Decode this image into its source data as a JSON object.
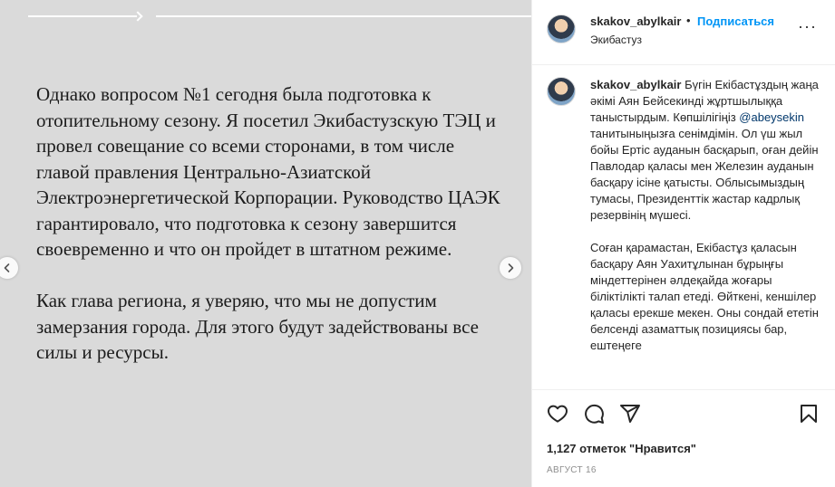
{
  "slide": {
    "paragraphs": [
      "Однако вопросом №1 сегодня была подготовка к отопительному сезону. Я посетил Экибастузскую ТЭЦ и провел совещание со всеми сторонами, в том числе главой правления Центрально-Азиатской Электроэнергетической Корпорации. Руководство ЦАЭК гарантировало, что подготовка к сезону завершится своевременно и что он пройдет в штатном режиме.",
      "Как глава региона, я уверяю, что мы не допустим замерзания города. Для этого будут задействованы все силы и ресурсы."
    ],
    "prev_icon": "chevron-left-icon",
    "next_icon": "chevron-right-icon"
  },
  "header": {
    "username": "skakov_abylkair",
    "separator": "•",
    "follow_label": "Подписаться",
    "location": "Экибастуз",
    "more_icon": "more-horizontal-icon"
  },
  "caption": {
    "username": "skakov_abylkair",
    "p1_start": "Бүгін Екібастұздың жаңа әкімі Аян Бейсекинді жұртшылыққа таныстырдым. Көпшілігіңіз",
    "mention": "@abeysekin",
    "p1_end": "танитыныңызға сенімдімін. Ол үш жыл бойы Ертіс ауданын басқарып, оған дейін Павлодар қаласы мен Железин ауданын басқару ісіне қатысты. Облысымыздың тумасы, Президенттік жастар кадрлық резервінің мүшесі.",
    "p2": "Соған қарамастан, Екібастұз қаласын басқару Аян Уахитұлынан бұрыңғы міндеттерінен әлдеқайда жоғары біліктілікті талап етеді. Өйткені, кеншілер қаласы ерекше мекен. Оны сондай ететін белсенді азаматтық позициясы бар, ештеңеге"
  },
  "actions": {
    "like_icon": "heart-icon",
    "comment_icon": "comment-icon",
    "share_icon": "send-icon",
    "save_icon": "bookmark-icon"
  },
  "likes_text": "1,127 отметок \"Нравится\"",
  "date": "АВГУСТ 16"
}
